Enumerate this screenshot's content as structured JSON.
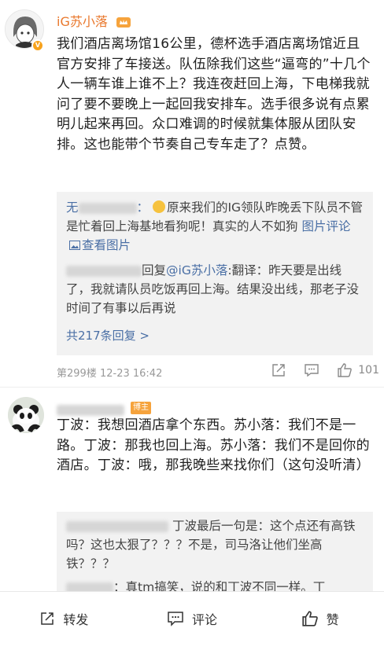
{
  "comment1": {
    "username": "iG苏小落",
    "verified_badge": "V",
    "text": "我们酒店离场馆16公里，德杯选手酒店离场馆近且官方安排了车接送。队伍除我们这些“逼弯的”十几个人一辆车谁上谁不上？我连夜赶回上海，下电梯我就问了要不要晚上一起回我安排车。选手很多说有点累明儿起来再回。众口难调的时候就集体服从团队安排。这也能带个节奏自己专车走了？点赞。",
    "replies": [
      {
        "name_prefix": "无",
        "text": "原来我们的IG领队昨晚丢下队员不管是忙着回上海基地看狗呢！真实的人不如狗",
        "picture_comment": "图片评论",
        "view_picture": "查看图片"
      },
      {
        "reply_to_label": "回复",
        "reply_to_user": "@iG苏小落",
        "text": ":翻译：昨天要是出线了，我就请队员吃饭再回上海。结果没出线，那老子没时间了有事以后再说"
      }
    ],
    "more_replies": "共217条回复 >",
    "floor": "第299楼",
    "time": "12-23 16:42",
    "like_count": "101"
  },
  "comment2": {
    "level_badge": "博主",
    "text": "丁波：我想回酒店拿个东西。苏小落：我们不是一路。丁波：那我也回上海。苏小落：我们不是回你的酒店。丁波：哦，那我晚些来找你们（这句没听清）",
    "replies": [
      {
        "text": "丁波最后一句是：这个点还有高铁吗？这也太狠了？？？不是，司马洛让他们坐高铁？？？"
      },
      {
        "text": "真tm搞笑，说的和丁波不同一样。丁"
      }
    ]
  },
  "bottom_bar": {
    "repost": "转发",
    "comment": "评论",
    "like": "赞"
  },
  "colors": {
    "username": "#e9772b",
    "link": "#4a6fa5",
    "reply_bg": "#f2f2f2"
  }
}
